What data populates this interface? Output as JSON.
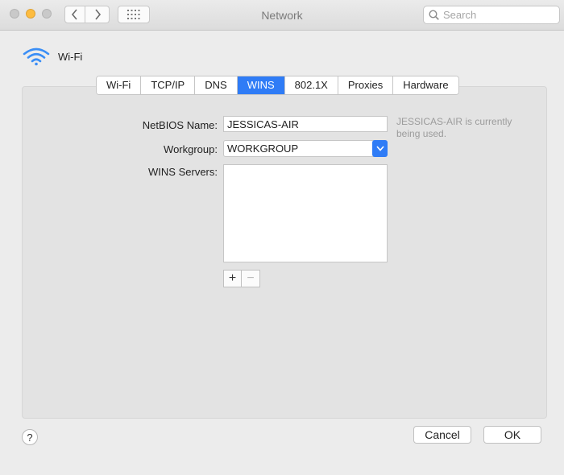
{
  "window": {
    "title": "Network"
  },
  "toolbar": {
    "back_icon": "chevron-left-icon",
    "forward_icon": "chevron-right-icon",
    "grid_icon": "grid-icon",
    "search_placeholder": "Search"
  },
  "interface": {
    "name": "Wi-Fi",
    "icon": "wifi-icon"
  },
  "tabs": [
    {
      "label": "Wi-Fi",
      "active": false
    },
    {
      "label": "TCP/IP",
      "active": false
    },
    {
      "label": "DNS",
      "active": false
    },
    {
      "label": "WINS",
      "active": true
    },
    {
      "label": "802.1X",
      "active": false
    },
    {
      "label": "Proxies",
      "active": false
    },
    {
      "label": "Hardware",
      "active": false
    }
  ],
  "wins": {
    "netbios_label": "NetBIOS Name:",
    "netbios_value": "JESSICAS-AIR",
    "netbios_hint": "JESSICAS-AIR is currently being used.",
    "workgroup_label": "Workgroup:",
    "workgroup_value": "WORKGROUP",
    "servers_label": "WINS Servers:",
    "servers": [],
    "add_label": "+",
    "remove_label": "−"
  },
  "footer": {
    "help_label": "?",
    "cancel_label": "Cancel",
    "ok_label": "OK"
  },
  "colors": {
    "accent": "#2f7cf6",
    "minimize": "#fdbc40"
  }
}
